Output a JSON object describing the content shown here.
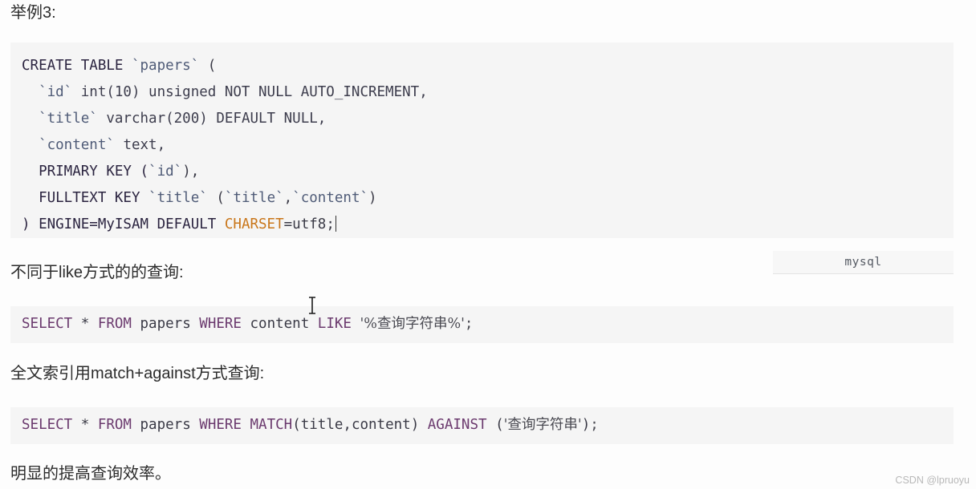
{
  "page": {
    "background_color": "#fdfdfd",
    "code_background_color": "#f5f5f5"
  },
  "paragraphs": {
    "intro": "举例3:",
    "unlike_query": "不同于like方式的的查询:",
    "fulltext_query": "全文索引用match+against方式查询:",
    "conclusion": "明显的提高查询效率。"
  },
  "language_tag": {
    "label": "mysql"
  },
  "code_blocks": {
    "create_table": {
      "language": "mysql",
      "lines": [
        "CREATE TABLE `papers` (",
        "  `id` int(10) unsigned NOT NULL AUTO_INCREMENT,",
        "  `title` varchar(200) DEFAULT NULL,",
        "  `content` text,",
        "  PRIMARY KEY (`id`),",
        "  FULLTEXT KEY `title` (`title`,`content`)",
        ") ENGINE=MyISAM DEFAULT CHARSET=utf8;"
      ],
      "tokens": {
        "l1_kw": "CREATE TABLE ",
        "l1_ident": "`papers`",
        "l1_rest": " (",
        "l2_ident": "  `id`",
        "l2_rest": " int(10) unsigned NOT NULL AUTO_INCREMENT,",
        "l3_ident": "  `title`",
        "l3_rest": " varchar(200) DEFAULT NULL,",
        "l4_ident": "  `content`",
        "l4_rest": " text,",
        "l5_rest": "  PRIMARY KEY (",
        "l5_ident": "`id`",
        "l5_tail": "),",
        "l6_rest": "  FULLTEXT KEY ",
        "l6_ident": "`title`",
        "l6_mid": " (",
        "l6_ident2": "`title`",
        "l6_comma": ",",
        "l6_ident3": "`content`",
        "l6_tail": ")",
        "l7_head": ") ENGINE=MyISAM DEFAULT ",
        "l7_charset": "CHARSET",
        "l7_tail": "=utf8;"
      }
    },
    "like_query": {
      "full": "SELECT * FROM papers WHERE content LIKE '%查询字符串%';",
      "tokens": {
        "kw1": "SELECT",
        "star": " * ",
        "kw2": "FROM",
        "table": " papers ",
        "kw3": "WHERE",
        "col": " content ",
        "kw4": "LIKE",
        "space": " ",
        "str": "'%查询字符串%'",
        "end": ";"
      }
    },
    "match_query": {
      "full": "SELECT * FROM papers WHERE MATCH(title,content) AGAINST ('查询字符串');",
      "tokens": {
        "kw1": "SELECT",
        "star": " * ",
        "kw2": "FROM",
        "table": " papers ",
        "kw3": "WHERE",
        "kw4": " MATCH",
        "args": "(title,content)",
        "kw5": " AGAINST",
        "open": " (",
        "str": "'查询字符串'",
        "close": ")",
        "end": ";"
      }
    }
  },
  "watermark": {
    "text": "CSDN @lpruoyu"
  }
}
